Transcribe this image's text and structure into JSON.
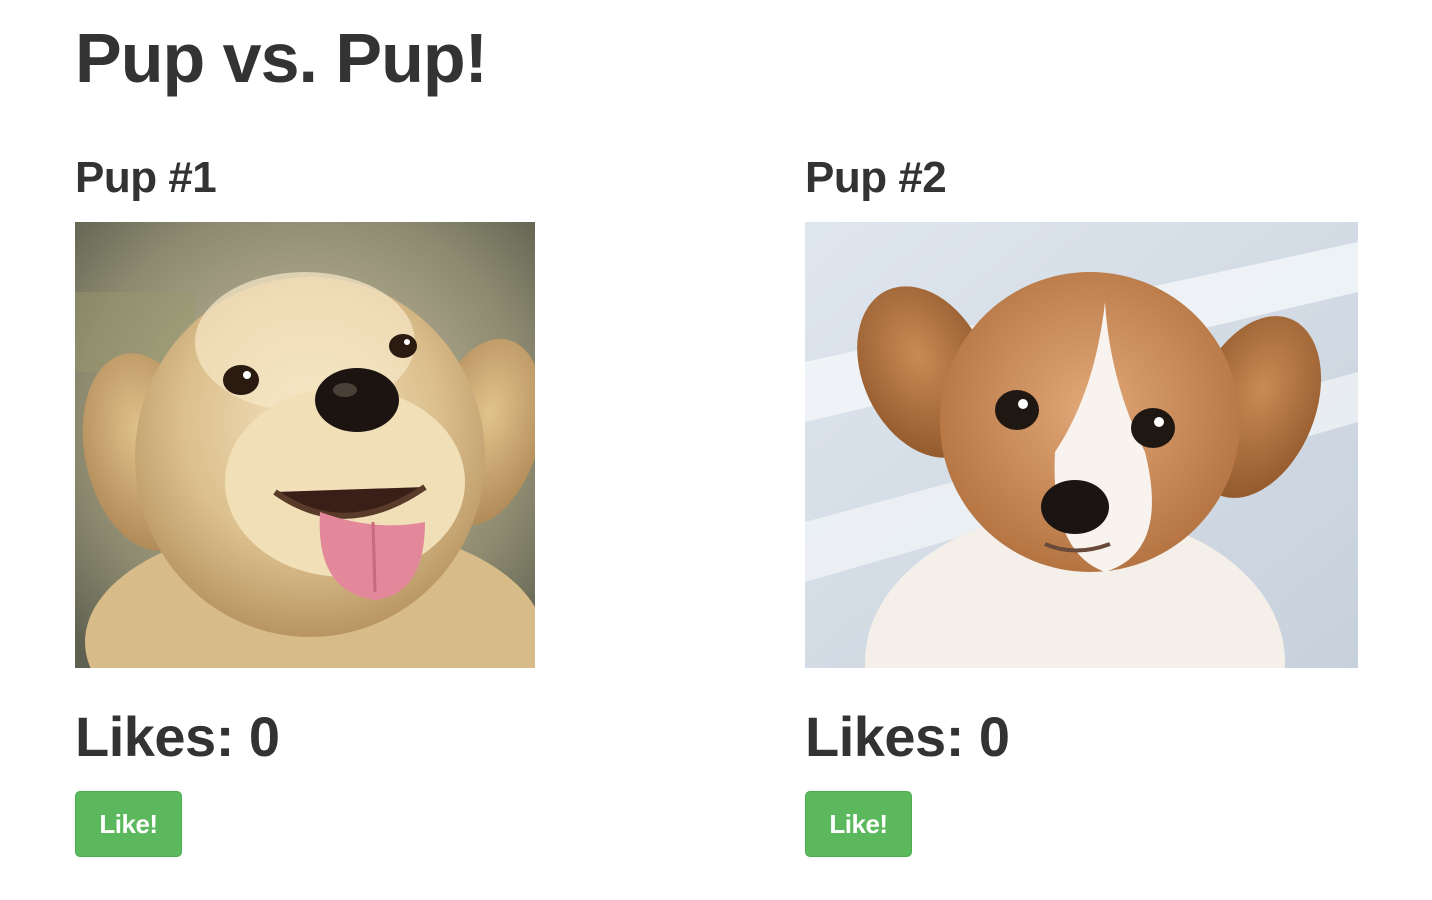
{
  "page": {
    "title": "Pup vs. Pup!"
  },
  "pups": [
    {
      "name": "Pup #1",
      "likes_label": "Likes:",
      "likes": 0,
      "button_label": "Like!",
      "photo": "golden-retriever-puppy-tongue-out"
    },
    {
      "name": "Pup #2",
      "likes_label": "Likes:",
      "likes": 0,
      "button_label": "Like!",
      "photo": "brown-white-puppy"
    }
  ],
  "colors": {
    "text": "#333333",
    "button": "#5cb85c",
    "button_border": "#4cae4c",
    "button_text": "#ffffff"
  }
}
